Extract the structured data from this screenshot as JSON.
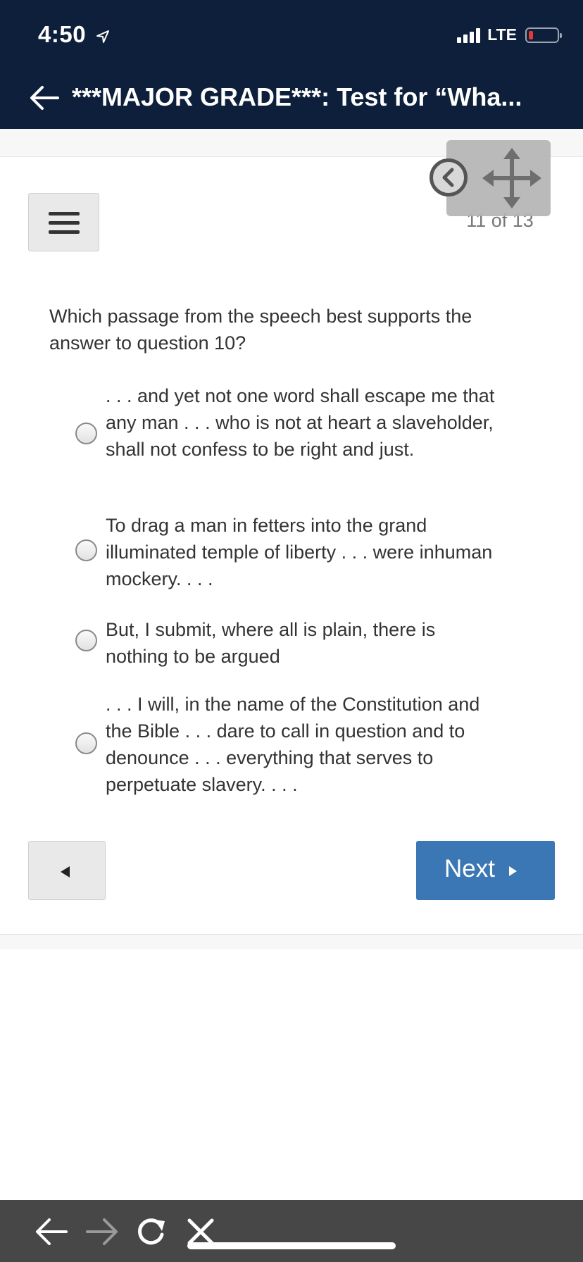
{
  "status_bar": {
    "time": "4:50",
    "network": "LTE",
    "icons": [
      "location-arrow-icon",
      "signal-icon",
      "battery-icon"
    ]
  },
  "header": {
    "title": "***MAJOR GRADE***: Test for “Wha...",
    "back_icon": "arrow-left-icon"
  },
  "quiz": {
    "counter": "11 of 13",
    "question": "Which passage from the speech best supports the answer to question 10?",
    "options": [
      {
        "text": ". . . and yet not one word shall escape me that any man . . . who is not at heart a slaveholder, shall not confess to be right and just.",
        "selected": false
      },
      {
        "text": "To drag a man in fetters into the grand illuminated temple of liberty . . . were inhuman mockery. . . .",
        "selected": false
      },
      {
        "text": "But, I submit, where all is plain, there is nothing to be argued",
        "selected": false
      },
      {
        "text": ". . . I will, in the name of the Constitution and the Bible . . . dare to call in question and to denounce . . . everything that serves to perpetuate slavery. . . .",
        "selected": false
      }
    ],
    "next_label": "Next"
  },
  "colors": {
    "header_bg": "#0d1f3a",
    "next_button": "#3a77b4",
    "toolbar_bg": "#474747"
  },
  "browser_toolbar": {
    "icons": [
      "back-arrow-icon",
      "forward-arrow-icon",
      "reload-icon",
      "close-icon"
    ]
  }
}
